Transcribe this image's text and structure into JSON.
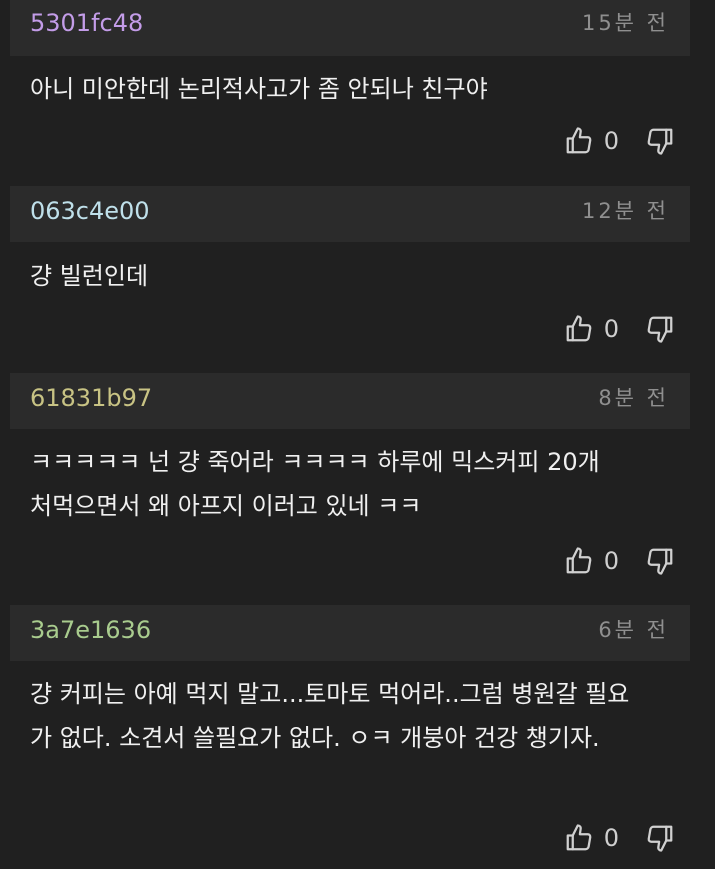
{
  "comments": [
    {
      "user": "5301fc48",
      "user_color": "#c39ce8",
      "time": "15분 전",
      "text": "아니 미안한데 논리적사고가 좀 안되나 친구야",
      "likes": "0"
    },
    {
      "user": "063c4e00",
      "user_color": "#bfe0ea",
      "time": "12분 전",
      "text": "걍 빌런인데",
      "likes": "0"
    },
    {
      "user": "61831b97",
      "user_color": "#c8c384",
      "time": "8분 전",
      "text": "ㅋㅋㅋㅋㅋ 넌 걍 죽어라 ㅋㅋㅋㅋ 하루에 믹스커피 20개\n처먹으면서 왜 아프지 이러고 있네 ㅋㅋ",
      "likes": "0"
    },
    {
      "user": "3a7e1636",
      "user_color": "#a9cc8e",
      "time": "6분 전",
      "text": "걍 커피는 아예 먹지 말고...토마토 먹어라..그럼 병원갈 필요\n가 없다. 소견서 쓸필요가 없다. ㅇㅋ 개붕아 건강 챙기자.",
      "likes": "0"
    }
  ],
  "icons": {
    "like": "thumbs-up-icon",
    "dislike": "thumbs-down-icon"
  }
}
